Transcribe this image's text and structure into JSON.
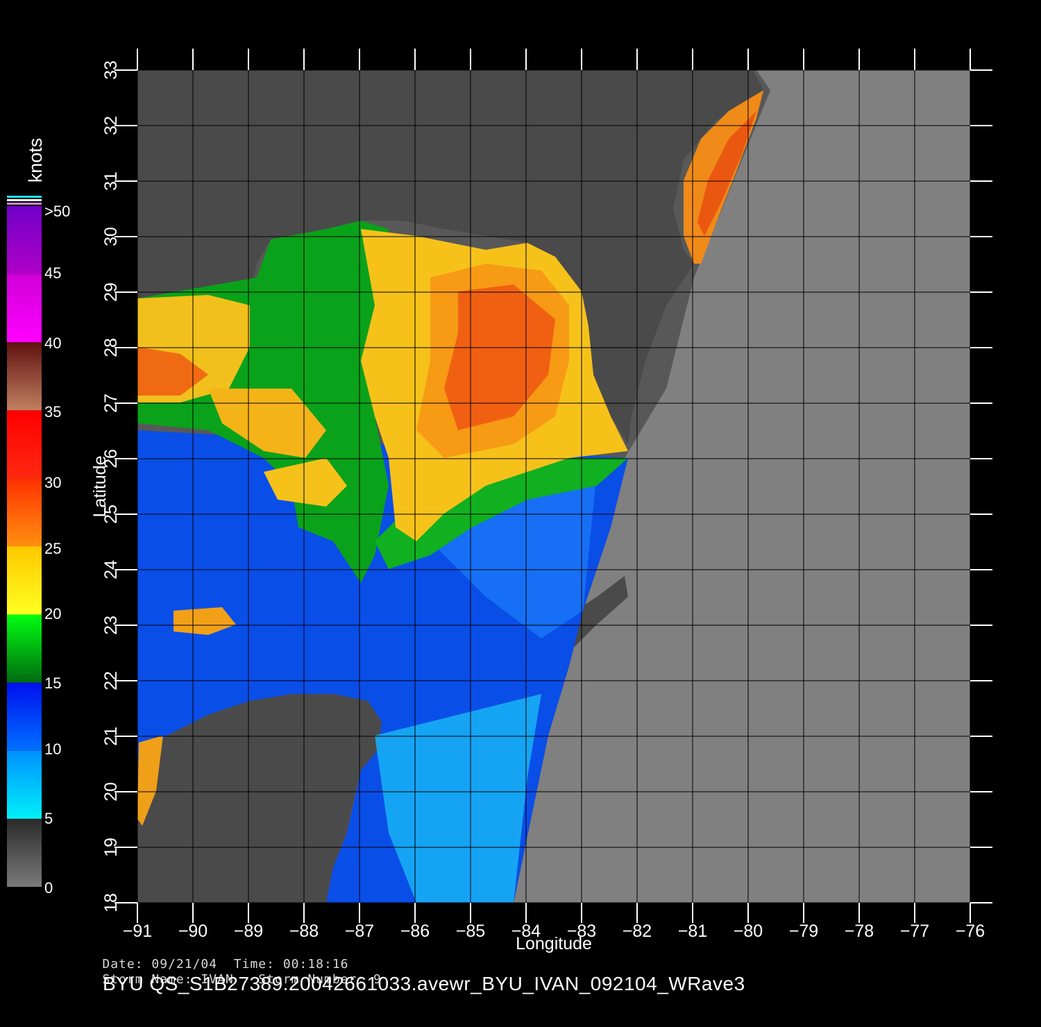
{
  "map": {
    "axes": {
      "x_label": "Longitude",
      "y_label": "Latitude",
      "x_range": [
        -91,
        -76
      ],
      "y_range": [
        18,
        33
      ],
      "x_ticks": [
        "−91",
        "−90",
        "−89",
        "−88",
        "−87",
        "−86",
        "−85",
        "−84",
        "−83",
        "−82",
        "−81",
        "−80",
        "−79",
        "−78",
        "−77",
        "−76"
      ],
      "y_ticks": [
        "18",
        "19",
        "20",
        "21",
        "22",
        "23",
        "24",
        "25",
        "26",
        "27",
        "28",
        "29",
        "30",
        "31",
        "32",
        "33"
      ],
      "grid": true
    },
    "legend": {
      "unit": "knots",
      "labels": [
        ">50",
        "45",
        "40",
        "35",
        "30",
        "25",
        "20",
        "15",
        "10",
        "5",
        "0"
      ],
      "bands": [
        {
          "from": 0,
          "to": 5,
          "colors": [
            "#7a7a7a",
            "#2a2a2a"
          ]
        },
        {
          "from": 5,
          "to": 10,
          "colors": [
            "#00f0f8",
            "#0090ff"
          ]
        },
        {
          "from": 10,
          "to": 15,
          "colors": [
            "#0070ff",
            "#0010f0"
          ]
        },
        {
          "from": 15,
          "to": 20,
          "colors": [
            "#006b10",
            "#00ff10"
          ]
        },
        {
          "from": 20,
          "to": 25,
          "colors": [
            "#ffff20",
            "#ffc800"
          ]
        },
        {
          "from": 25,
          "to": 30,
          "colors": [
            "#ff9010",
            "#ff3000"
          ]
        },
        {
          "from": 30,
          "to": 35,
          "colors": [
            "#ff2810",
            "#ff0000"
          ]
        },
        {
          "from": 35,
          "to": 40,
          "colors": [
            "#c08060",
            "#601010"
          ]
        },
        {
          "from": 40,
          "to": 45,
          "colors": [
            "#ff00ff",
            "#d000d8"
          ]
        },
        {
          "from": 45,
          "to": 50,
          "colors": [
            "#b000c8",
            "#7000c8"
          ]
        }
      ]
    },
    "colors": {
      "background": "#000000",
      "ocean_no_data": "#808080",
      "land": "#4a4a4a",
      "swath_edge": "#5a5a5a",
      "grid": "#000000",
      "tick": "#ffffff"
    }
  },
  "info": {
    "date_label": "Date:",
    "date": "09/21/04",
    "time_label": "Time:",
    "time": "00:18:16",
    "storm_name_label": "Storm Name:",
    "storm_name": "IVAN",
    "storm_number_label": "Storm Number:",
    "storm_number": "9",
    "product": "BYU QS_S1B27389.20042661033.avewr_BYU_IVAN_092104_WRave3"
  }
}
